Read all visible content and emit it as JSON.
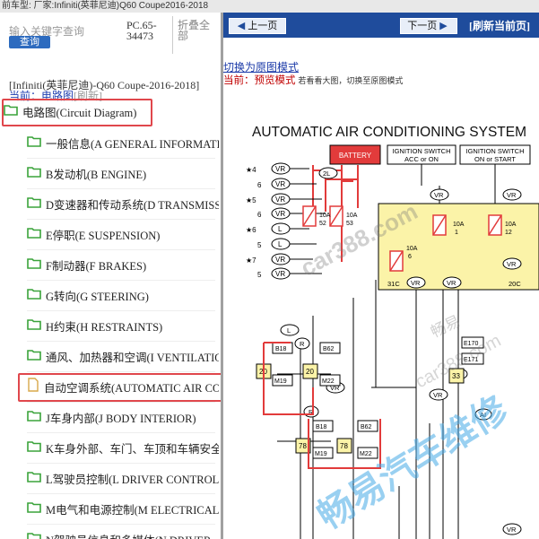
{
  "top_strip": "前车型:  厂家:Infiniti(英菲尼迪)Q60 Coupe2016-2018",
  "left": {
    "search_placeholder": "输入关键字查询",
    "search_button": "查询",
    "pc_code": "PC.65-34473",
    "fold_all": "折叠全部",
    "breadcrumb": "[Infiniti(英菲尼迪)-Q60 Coupe-2016-2018]",
    "current_label": "当前：电路图",
    "refresh_label": "[刷新]",
    "root": "电路图(Circuit Diagram)",
    "items": [
      "一般信息(A GENERAL INFORMATION)",
      "B发动机(B ENGINE)",
      "D变速器和传动系统(D TRANSMISSION & DRIVELINE)",
      "E停职(E SUSPENSION)",
      "F制动器(F BRAKES)",
      "G转向(G STEERING)",
      "H约束(H RESTRAINTS)",
      "通风、加热器和空调(I VENTILATION)",
      "自动空调系统(AUTOMATIC AIR CONDITIONING)",
      "J车身内部(J BODY INTERIOR)",
      "K车身外部、车门、车顶和车辆安全",
      "L驾驶员控制(L DRIVER CONTROLS)",
      "M电气和电源控制(M ELECTRICAL)",
      "N驾驶员信息和多媒体(N DRIVER"
    ],
    "selected_index": 8
  },
  "right": {
    "prev_page": "上一页",
    "next_page": "下一页",
    "refresh_page": "[刷新当前页]",
    "switch_mode": "切换为原图模式",
    "current_mode_label": "当前：预览模式",
    "mode_hint": "若看看大图，切换至原图模式",
    "diagram": {
      "title": "AUTOMATIC AIR CONDITIONING SYSTEM",
      "battery": "BATTERY",
      "ign1": [
        "IGNITION SWITCH",
        "ACC or ON"
      ],
      "ign2": [
        "IGNITION SWITCH",
        "ON or START"
      ],
      "left_labels": [
        {
          "star": "★4",
          "num": "4",
          "tag": "VR"
        },
        {
          "star": "",
          "num": "6",
          "tag": "VR"
        },
        {
          "star": "★5",
          "num": "5",
          "tag": "VR"
        },
        {
          "star": "",
          "num": "6",
          "tag": "VR"
        },
        {
          "star": "★6",
          "num": "6",
          "tag": "L"
        },
        {
          "star": "",
          "num": "5",
          "tag": "L"
        },
        {
          "star": "★7",
          "num": "4",
          "tag": "VR"
        },
        {
          "star": "",
          "num": "5",
          "tag": "VR"
        }
      ],
      "fuses": [
        "10A\n52",
        "10A\n53",
        "10A\n1",
        "10A\n12",
        "10A\n6"
      ],
      "wire_tags": [
        "2L",
        "VR",
        "VR",
        "VR",
        "2L",
        "VR",
        "L",
        "VR",
        "L",
        "R",
        "R",
        "VR",
        "VR",
        "AI",
        "VR"
      ],
      "connectors": [
        "31C",
        "20C",
        "B18",
        "B62",
        "M19",
        "M22",
        "B18",
        "B62",
        "M19",
        "M22",
        "E170",
        "E171"
      ],
      "yellow_nums": [
        "20",
        "20",
        "78",
        "78",
        "33"
      ],
      "watermarks": [
        "car388.com",
        "car388.com",
        "畅易汽车维修",
        "畅易"
      ]
    }
  }
}
